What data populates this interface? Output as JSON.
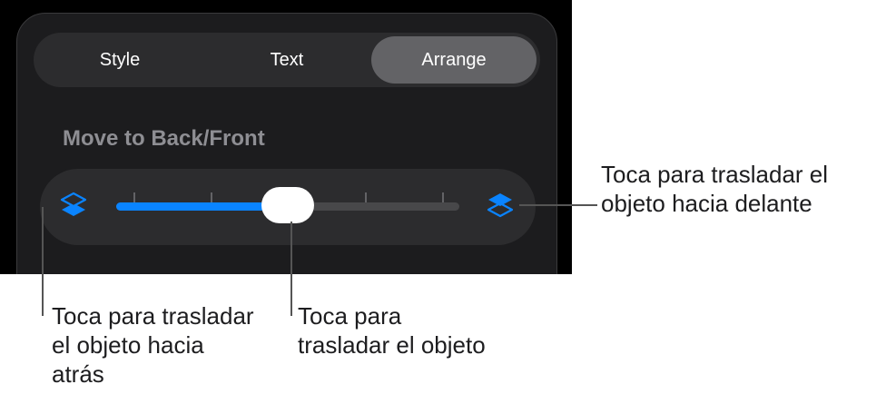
{
  "tabs": [
    {
      "label": "Style",
      "active": false
    },
    {
      "label": "Text",
      "active": false
    },
    {
      "label": "Arrange",
      "active": true
    }
  ],
  "section_title": "Move to Back/Front",
  "slider": {
    "position": 0.5,
    "ticks": 5,
    "back_icon": "layers-back-icon",
    "front_icon": "layers-front-icon",
    "accent_color": "#0a84ff"
  },
  "callouts": {
    "front": {
      "line1": "Toca para trasladar el",
      "line2": "objeto hacia delante"
    },
    "back": {
      "line1": "Toca para trasladar",
      "line2": "el objeto hacia",
      "line3": "atrás"
    },
    "drag": {
      "line1": "Toca para",
      "line2": "trasladar el objeto"
    }
  }
}
